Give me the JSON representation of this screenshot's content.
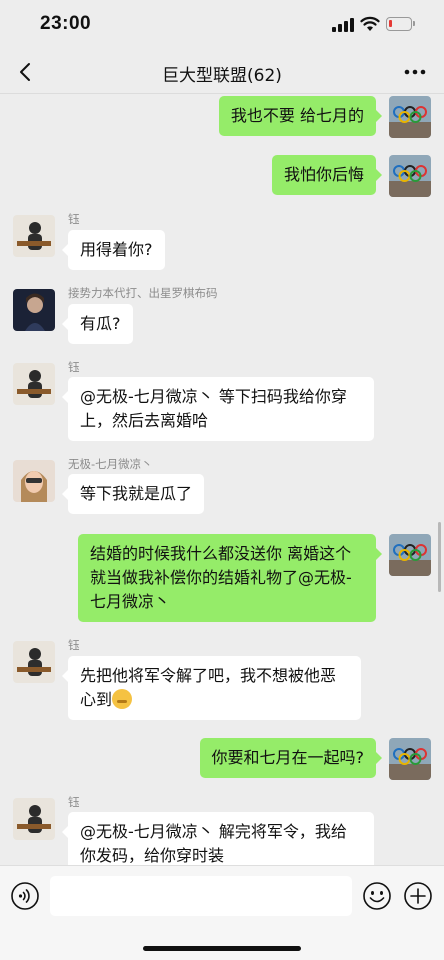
{
  "status_bar": {
    "time": "23:00",
    "battery_percent": 15,
    "icons": [
      "signal-icon",
      "wifi-icon",
      "battery-icon"
    ]
  },
  "nav": {
    "title": "巨大型联盟(62)",
    "back_icon": "chevron-left-icon",
    "more_icon": "more-dots-icon"
  },
  "messages": [
    {
      "direction": "out",
      "text": "我也不要 给七月的"
    },
    {
      "direction": "out",
      "text": "我怕你后悔"
    },
    {
      "direction": "in",
      "sender": "钰",
      "text": "用得着你?"
    },
    {
      "direction": "in",
      "sender": "接势力本代打、出星罗棋布码",
      "text": "有瓜?"
    },
    {
      "direction": "in",
      "sender": "钰",
      "text": "@无极-七月微凉丶 等下扫码我给你穿上，然后去离婚哈"
    },
    {
      "direction": "in",
      "sender": "无极-七月微凉丶",
      "text": "等下我就是瓜了"
    },
    {
      "direction": "out",
      "text": "结婚的时候我什么都没送你 离婚这个就当做我补偿你的结婚礼物了@无极-七月微凉丶"
    },
    {
      "direction": "in",
      "sender": "钰",
      "text": "先把他将军令解了吧，我不想被他恶心到",
      "emoji": "thinking-face-emoji"
    },
    {
      "direction": "out",
      "text": "你要和七月在一起吗?"
    },
    {
      "direction": "in",
      "sender": "钰",
      "text": "@无极-七月微凉丶 解完将军令，我给你发码，给你穿时装"
    }
  ],
  "input_bar": {
    "placeholder": "",
    "voice_icon": "voice-icon",
    "emoji_icon": "emoji-icon",
    "plus_icon": "plus-icon"
  },
  "colors": {
    "background": "#ededed",
    "outgoing_bubble": "#95ec69",
    "incoming_bubble": "#ffffff",
    "sender_name": "#8c8c8c"
  }
}
